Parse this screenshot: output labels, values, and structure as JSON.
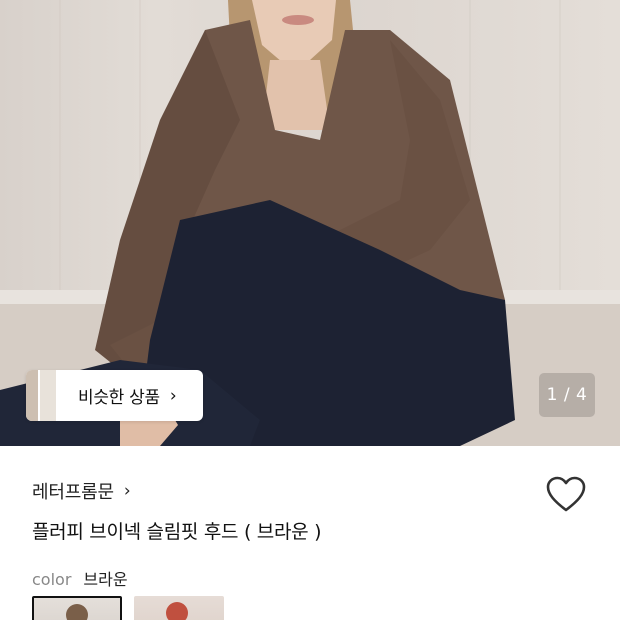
{
  "gallery": {
    "similar_button_label": "비슷한 상품",
    "similar_chevron": "›",
    "counter": "1 / 4",
    "current_image": 1,
    "total_images": 4
  },
  "product": {
    "brand": "레터프롬문",
    "brand_chevron": "›",
    "title": "플러피 브이넥 슬림핏 후드 ( 브라운 )",
    "favorited": false
  },
  "options": {
    "color_label": "color",
    "color_value": "브라운",
    "swatches": [
      {
        "name": "브라운",
        "selected": true
      },
      {
        "name": "레드",
        "selected": false
      }
    ]
  },
  "colors": {
    "sweater": "#6f5648",
    "jeans": "#1d2233",
    "accent": "#111111"
  }
}
